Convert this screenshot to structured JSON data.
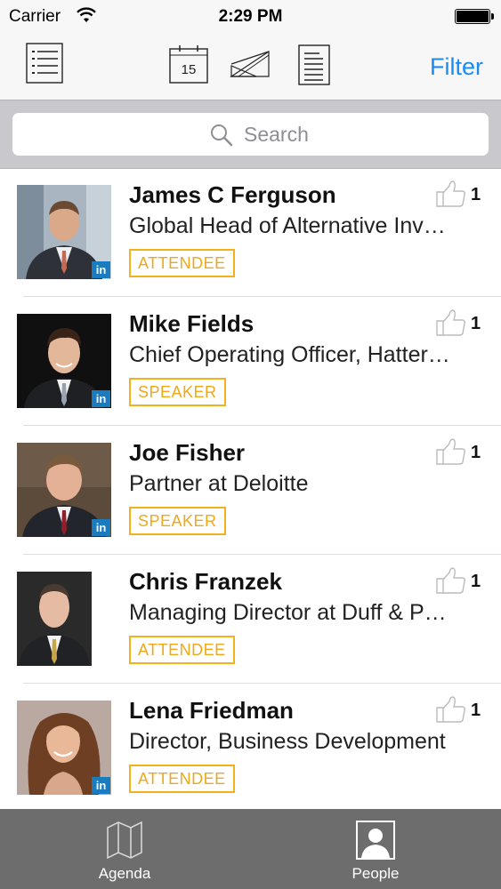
{
  "status_bar": {
    "carrier": "Carrier",
    "time": "2:29 PM"
  },
  "nav": {
    "filter_label": "Filter",
    "calendar_day": "15"
  },
  "search": {
    "placeholder": "Search"
  },
  "people": [
    {
      "name": "James C Ferguson",
      "title": "Global Head of Alternative Inv…",
      "badge": "ATTENDEE",
      "likes": "1"
    },
    {
      "name": "Mike Fields",
      "title": "Chief Operating Officer, Hatter…",
      "badge": "SPEAKER",
      "likes": "1"
    },
    {
      "name": "Joe Fisher",
      "title": "Partner at Deloitte",
      "badge": "SPEAKER",
      "likes": "1"
    },
    {
      "name": "Chris Franzek",
      "title": "Managing Director at Duff & P…",
      "badge": "ATTENDEE",
      "likes": "1"
    },
    {
      "name": "Lena Friedman",
      "title": "Director, Business Development",
      "badge": "ATTENDEE",
      "likes": "1"
    }
  ],
  "linkedin_label": "in",
  "tabs": [
    {
      "label": "Agenda"
    },
    {
      "label": "People"
    }
  ],
  "colors": {
    "accent": "#1a8cf0",
    "badge": "#f0a81a",
    "tabbar": "#6d6d6d",
    "linkedin": "#1a7bbf"
  }
}
